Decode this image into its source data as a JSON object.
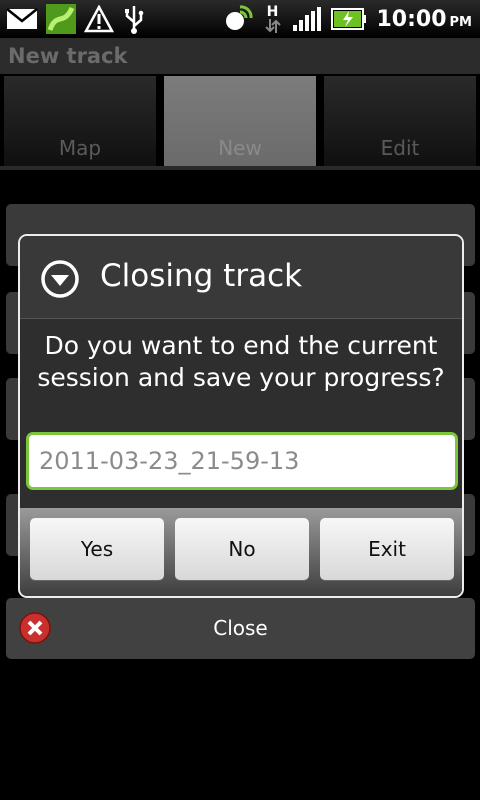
{
  "status_bar": {
    "time": "10:00",
    "ampm": "PM",
    "network_type": "H",
    "icons": [
      "mail-icon",
      "app-icon",
      "warning-icon",
      "usb-icon",
      "gps-icon",
      "network-h-icon",
      "signal-icon",
      "battery-charging-icon"
    ]
  },
  "app": {
    "title": "New track"
  },
  "tabs": [
    {
      "label": "Map"
    },
    {
      "label": "New"
    },
    {
      "label": "Edit"
    }
  ],
  "background": {
    "close_label": "Close"
  },
  "dialog": {
    "title": "Closing track",
    "message": "Do you want to end the current session and save your progress?",
    "input_value": "2011-03-23_21-59-13",
    "buttons": {
      "yes": "Yes",
      "no": "No",
      "exit": "Exit"
    }
  },
  "colors": {
    "accent": "#7cc63c",
    "dialog_border": "#ededed",
    "close_icon": "#c8302e"
  }
}
